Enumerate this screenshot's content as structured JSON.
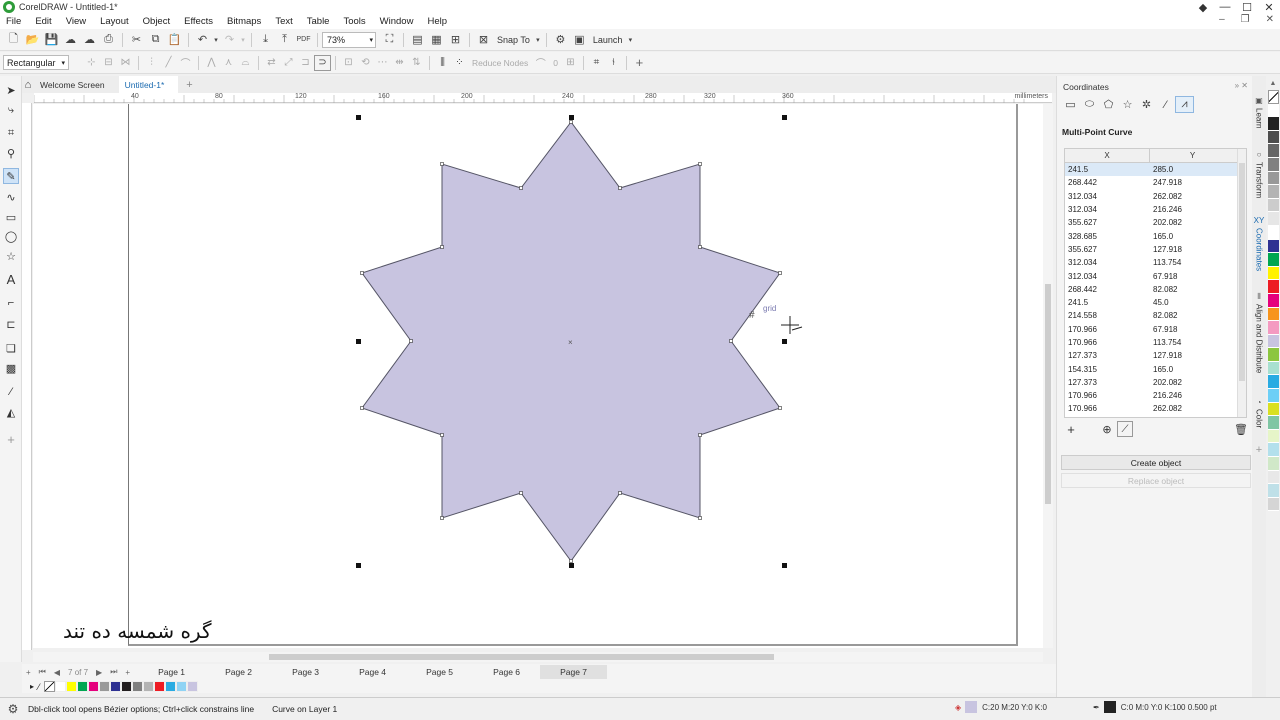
{
  "window": {
    "title": "CorelDRAW - Untitled-1*",
    "controls": [
      "◆",
      "—",
      "☐",
      "✕"
    ]
  },
  "menu": {
    "items": [
      "File",
      "Edit",
      "View",
      "Layout",
      "Object",
      "Effects",
      "Bitmaps",
      "Text",
      "Table",
      "Tools",
      "Window",
      "Help"
    ]
  },
  "toolbar": {
    "zoom": "73%",
    "snap_label": "Snap To",
    "launch_label": "Launch"
  },
  "propbar": {
    "shape_mode": "Rectangular",
    "reduce_nodes": "Reduce Nodes",
    "node_count": "0"
  },
  "tabs": {
    "welcome": "Welcome Screen",
    "doc": "Untitled-1*"
  },
  "ruler": {
    "labels": [
      "40",
      "80",
      "120",
      "160",
      "200",
      "240",
      "280",
      "320",
      "360"
    ],
    "unit": "millimeters"
  },
  "canvas": {
    "arabic_text": "گره شمسه ده تند",
    "snap_hint": "grid",
    "star_fill": "#c8c4e0",
    "star_stroke": "#555566"
  },
  "pages": {
    "count_label": "7 of 7",
    "tabs": [
      "Page 1",
      "Page 2",
      "Page 3",
      "Page 4",
      "Page 5",
      "Page 6",
      "Page 7"
    ],
    "active_index": 6
  },
  "palette_bottom": [
    "#ffffff",
    "#ffff00",
    "#00a651",
    "#e5007d",
    "#999999",
    "#2e3192",
    "#231f20",
    "#808080",
    "#b3b3b3",
    "#ed1c24",
    "#29abe2",
    "#8fd3f4",
    "#c8c4e0"
  ],
  "palette_right": [
    "#ffffff",
    "#222222",
    "#4d4d4d",
    "#666666",
    "#808080",
    "#999999",
    "#b3b3b3",
    "#cccccc",
    "#e6e6e6",
    "#ffffff",
    "#2e3192",
    "#00a651",
    "#fff200",
    "#ed1c24",
    "#e5007d",
    "#f7941d",
    "#f49ac1",
    "#c8c4e0",
    "#8cc63f",
    "#a8e0d0",
    "#29abe2",
    "#6dcff6",
    "#d9e021",
    "#7fc6a4",
    "#e6f5c8",
    "#b3e0ec",
    "#d0e8c8",
    "#e8e8e8",
    "#bfe0e8",
    "#d5d5d5"
  ],
  "status": {
    "hint": "Dbl-click tool opens Bézier options; Ctrl+click constrains line",
    "object_info": "Curve on Layer 1",
    "fill_info": "C:20 M:20 Y:0 K:0",
    "outline_info": "C:0 M:0 Y:0 K:100  0.500 pt",
    "fill_color": "#c8c4e0"
  },
  "docker": {
    "title": "Coordinates",
    "mode_label": "Multi-Point Curve",
    "col_x": "X",
    "col_y": "Y",
    "rows": [
      [
        "241.5",
        "285.0"
      ],
      [
        "268.442",
        "247.918"
      ],
      [
        "312.034",
        "262.082"
      ],
      [
        "312.034",
        "216.246"
      ],
      [
        "355.627",
        "202.082"
      ],
      [
        "328.685",
        "165.0"
      ],
      [
        "355.627",
        "127.918"
      ],
      [
        "312.034",
        "113.754"
      ],
      [
        "312.034",
        "67.918"
      ],
      [
        "268.442",
        "82.082"
      ],
      [
        "241.5",
        "45.0"
      ],
      [
        "214.558",
        "82.082"
      ],
      [
        "170.966",
        "67.918"
      ],
      [
        "170.966",
        "113.754"
      ],
      [
        "127.373",
        "127.918"
      ],
      [
        "154.315",
        "165.0"
      ],
      [
        "127.373",
        "202.082"
      ],
      [
        "170.966",
        "216.246"
      ],
      [
        "170.966",
        "262.082"
      ]
    ],
    "create_btn": "Create object",
    "replace_btn": "Replace object"
  },
  "dock_tabs": [
    "Learn",
    "Transform",
    "Coordinates",
    "Align and Distribute",
    "Color"
  ]
}
